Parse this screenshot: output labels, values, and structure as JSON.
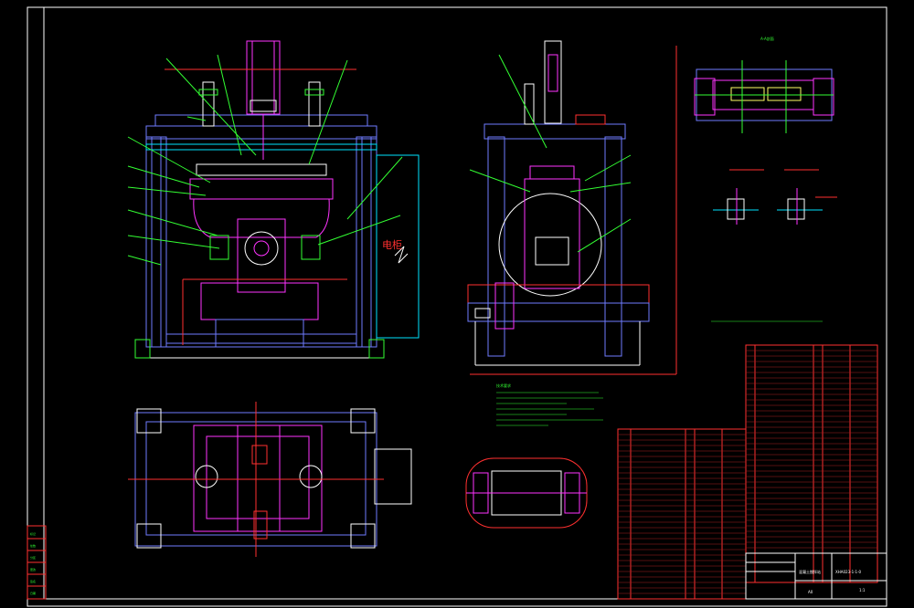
{
  "drawing": {
    "title_block": {
      "drawing_number": "XHA023-1-1-0",
      "name": "混凝土搅拌站",
      "scale": "1:1",
      "sheet": "A0"
    },
    "callout_text": "电柜",
    "top_right_label": "A-A剖面",
    "notes_heading": "技术要求",
    "side_panel_items": [
      "标记",
      "处数",
      "分区",
      "更改",
      "签名",
      "日期"
    ]
  },
  "colors": {
    "background": "#000000",
    "border": "#ffffff",
    "frame_blue": "#6f7cff",
    "frame_cyan": "#00e5ff",
    "magenta": "#ff33ff",
    "green": "#33ff33",
    "red": "#ff3030",
    "white": "#ffffff",
    "yellow": "#ffff66"
  }
}
